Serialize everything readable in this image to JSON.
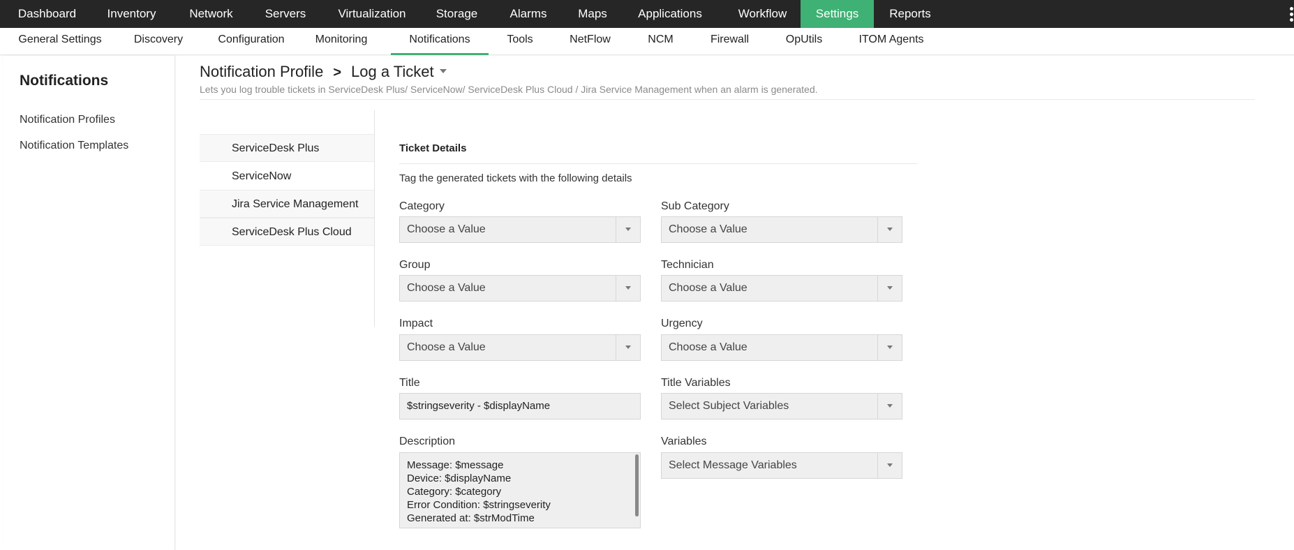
{
  "topnav": {
    "tabs": [
      "Dashboard",
      "Inventory",
      "Network",
      "Servers",
      "Virtualization",
      "Storage",
      "Alarms",
      "Maps",
      "Applications",
      "Workflow",
      "Settings",
      "Reports"
    ],
    "active": "Settings"
  },
  "subnav": {
    "tabs": [
      "General Settings",
      "Discovery",
      "Configuration",
      "Monitoring",
      "Notifications",
      "Tools",
      "NetFlow",
      "NCM",
      "Firewall",
      "OpUtils",
      "ITOM Agents"
    ],
    "active": "Notifications"
  },
  "sidebar": {
    "title": "Notifications",
    "items": [
      "Notification Profiles",
      "Notification Templates"
    ]
  },
  "breadcrumb": {
    "parent": "Notification Profile",
    "separator": ">",
    "current": "Log a Ticket",
    "description": "Lets you log trouble tickets in ServiceDesk Plus/ ServiceNow/ ServiceDesk Plus Cloud / Jira Service Management when an alarm is generated."
  },
  "vendors": {
    "items": [
      "ServiceDesk Plus",
      "ServiceNow",
      "Jira Service Management",
      "ServiceDesk Plus Cloud"
    ],
    "active": "ServiceNow"
  },
  "form": {
    "title": "Ticket Details",
    "subtitle": "Tag the generated tickets with the following details",
    "category_label": "Category",
    "category_value": "Choose a Value",
    "subcategory_label": "Sub Category",
    "subcategory_value": "Choose a Value",
    "group_label": "Group",
    "group_value": "Choose a Value",
    "technician_label": "Technician",
    "technician_value": "Choose a Value",
    "impact_label": "Impact",
    "impact_value": "Choose a Value",
    "urgency_label": "Urgency",
    "urgency_value": "Choose a Value",
    "title_label": "Title",
    "title_value": "$stringseverity - $displayName",
    "title_vars_label": "Title Variables",
    "title_vars_value": "Select Subject Variables",
    "description_label": "Description",
    "description_lines": [
      "Message: $message",
      "Device: $displayName",
      "Category: $category",
      "Error Condition: $stringseverity",
      "Generated at: $strModTime"
    ],
    "variables_label": "Variables",
    "variables_value": "Select Message Variables"
  },
  "colors": {
    "topnav_bg": "#262626",
    "accent": "#3fb174"
  }
}
